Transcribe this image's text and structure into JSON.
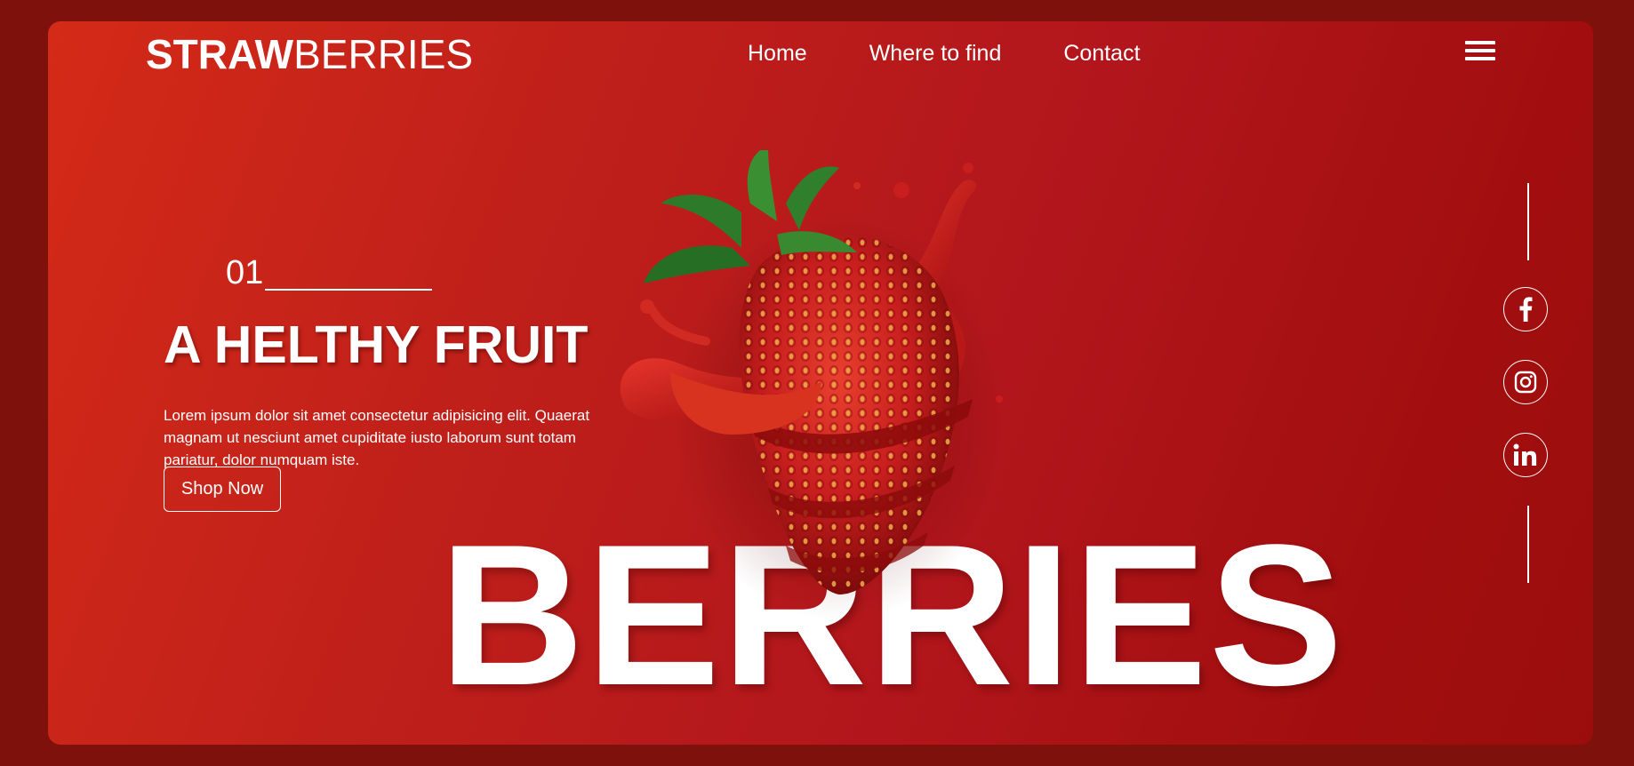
{
  "brand": {
    "bold_part": "STRAW",
    "thin_part": "BERRIES"
  },
  "nav": {
    "items": [
      {
        "label": "Home"
      },
      {
        "label": "Where to find"
      },
      {
        "label": "Contact"
      }
    ]
  },
  "hero": {
    "slide_number": "01",
    "headline": "A HELTHY FRUIT",
    "description": "Lorem ipsum dolor sit amet consectetur adipisicing elit. Quaerat magnam ut nesciunt amet cupiditate iusto laborum sunt totam pariatur, dolor numquam iste.",
    "cta_label": "Shop Now",
    "big_word": "BERRIES"
  },
  "social": {
    "items": [
      {
        "icon": "facebook-icon"
      },
      {
        "icon": "instagram-icon"
      },
      {
        "icon": "linkedin-icon"
      }
    ]
  },
  "colors": {
    "background": "#7f110c",
    "card_gradient_start": "#d42a18",
    "card_gradient_end": "#9b0d0d",
    "text": "#ffffff"
  }
}
